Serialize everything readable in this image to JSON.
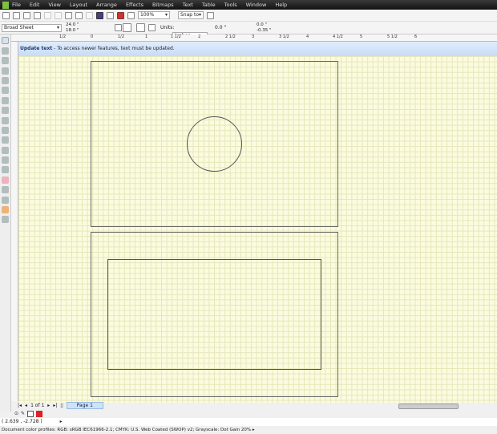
{
  "menu": [
    "File",
    "Edit",
    "View",
    "Layout",
    "Arrange",
    "Effects",
    "Bitmaps",
    "Text",
    "Table",
    "Tools",
    "Window",
    "Help"
  ],
  "toolbar": {
    "zoom_level": "100%",
    "snap_to": "Snap to"
  },
  "propbar": {
    "page_size": "Broad Sheet",
    "width": "24.0 \"",
    "height": "18.0 \"",
    "units_label": "Units:",
    "units_value": "inches",
    "nudge": "0.0 \"",
    "dup_x": "0.0 \"",
    "dup_y": "-0.35 \""
  },
  "ruler_labels": [
    "1/2",
    "0",
    "1/2",
    "1",
    "1 1/2",
    "2",
    "2 1/2",
    "3",
    "3 1/2",
    "4",
    "4 1/2",
    "5",
    "5 1/2",
    "6"
  ],
  "update_bar": {
    "title": "Update text",
    "message": " - To access newer features, text must be updated."
  },
  "page_nav": {
    "counter": "1 of 1",
    "page_tab": "Page 1"
  },
  "status": {
    "coordinates": "( 2.639 , -2.728 )",
    "color_profiles": "Document color profiles: RGB: sRGB IEC61966-2.1; CMYK: U.S. Web Coated (SWOP) v2; Grayscale: Dot Gain 20%"
  },
  "colors": {
    "fill_swatch": "#e02020",
    "grid": "#e6e6b8",
    "canvas": "#fbfbe0"
  }
}
